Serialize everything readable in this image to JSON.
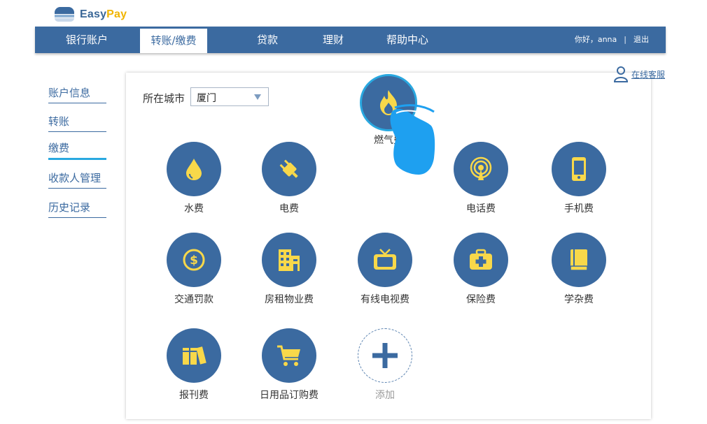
{
  "brand": {
    "name_part1": "Easy",
    "name_part2": "Pay",
    "color_primary": "#3b6aa0",
    "color_accent": "#f0b400"
  },
  "nav": {
    "items": [
      {
        "label": "银行账户",
        "active": false
      },
      {
        "label": "转账/缴费",
        "active": true
      },
      {
        "label": "贷款",
        "active": false
      },
      {
        "label": "理财",
        "active": false
      },
      {
        "label": "帮助中心",
        "active": false
      }
    ],
    "greeting": "你好，anna",
    "separator": "|",
    "logout": "退出"
  },
  "sidebar": {
    "items": [
      {
        "label": "账户信息",
        "active": false
      },
      {
        "label": "转账",
        "active": false
      },
      {
        "label": "缴费",
        "active": true
      },
      {
        "label": "收款人管理",
        "active": false
      },
      {
        "label": "历史记录",
        "active": false
      }
    ]
  },
  "support": {
    "label": "在线客服",
    "icon": "user-icon"
  },
  "city": {
    "label": "所在城市",
    "value": "厦门"
  },
  "services": [
    {
      "label": "水费",
      "icon": "water-drop-icon"
    },
    {
      "label": "电费",
      "icon": "plug-icon"
    },
    {
      "label": "燃气费",
      "icon": "flame-icon",
      "highlighted": true
    },
    {
      "label": "电话费",
      "icon": "signal-tower-icon"
    },
    {
      "label": "手机费",
      "icon": "mobile-phone-icon"
    },
    {
      "label": "交通罚款",
      "icon": "dollar-coin-icon"
    },
    {
      "label": "房租物业费",
      "icon": "building-icon"
    },
    {
      "label": "有线电视费",
      "icon": "tv-icon"
    },
    {
      "label": "保险费",
      "icon": "medical-kit-icon"
    },
    {
      "label": "学杂费",
      "icon": "book-icon"
    },
    {
      "label": "报刊费",
      "icon": "books-icon"
    },
    {
      "label": "日用品订购费",
      "icon": "shopping-cart-icon"
    },
    {
      "label": "添加",
      "icon": "plus-icon"
    }
  ],
  "colors": {
    "icon_yellow": "#f8d84a",
    "highlight_ring": "#29a8e0",
    "hand": "#1ea0f0"
  }
}
